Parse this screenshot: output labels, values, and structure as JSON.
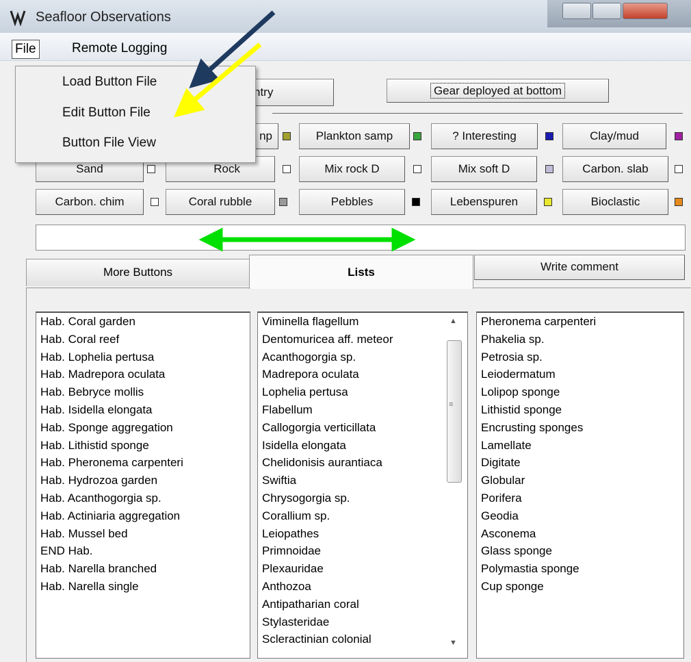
{
  "window": {
    "title": "Seafloor Observations"
  },
  "menubar": {
    "file": "File",
    "remote": "Remote Logging"
  },
  "file_menu": {
    "items": [
      "Load Button File",
      "Edit Button File",
      "Button File View"
    ]
  },
  "toolbar": {
    "entry_label": "ntry",
    "gear_label": "Gear deployed at bottom"
  },
  "buttons_row1": [
    {
      "label": "np",
      "color": "#a0a030"
    },
    {
      "label": "Plankton samp",
      "color": "#3aa640"
    },
    {
      "label": "? Interesting",
      "color": "#1b1bb0"
    },
    {
      "label": "Clay/mud",
      "color": "#a020a0"
    }
  ],
  "buttons_row2": [
    {
      "label": "Sand",
      "color": "#ffffff"
    },
    {
      "label": "Rock",
      "color": "#ffffff"
    },
    {
      "label": "Mix rock D",
      "color": "#ffffff"
    },
    {
      "label": "Mix soft D",
      "color": "#c0bcd8"
    },
    {
      "label": "Carbon. slab",
      "color": "#ffffff"
    }
  ],
  "buttons_row3": [
    {
      "label": "Carbon. chim",
      "color": "#ffffff"
    },
    {
      "label": "Coral rubble",
      "color": "#9a9a9a"
    },
    {
      "label": "Pebbles",
      "color": "#000000"
    },
    {
      "label": "Lebenspuren",
      "color": "#e8e830"
    },
    {
      "label": "Bioclastic",
      "color": "#e68a1e"
    }
  ],
  "tabs": {
    "more": "More Buttons",
    "lists": "Lists",
    "write_comment": "Write comment"
  },
  "list_habitats": [
    "Hab. Coral garden",
    "Hab. Coral reef",
    "Hab. Lophelia pertusa",
    "Hab. Madrepora oculata",
    "Hab. Bebryce mollis",
    "Hab. Isidella elongata",
    "Hab. Sponge aggregation",
    "Hab. Lithistid sponge",
    "Hab. Pheronema carpenteri",
    "Hab. Hydrozoa garden",
    "Hab. Acanthogorgia sp.",
    "Hab. Actiniaria aggregation",
    "Hab. Mussel bed",
    "END Hab.",
    "Hab. Narella branched",
    "Hab. Narella single"
  ],
  "list_corals": [
    "Viminella flagellum",
    "Dentomuricea aff. meteor",
    "Acanthogorgia sp.",
    "Madrepora oculata",
    "Lophelia pertusa",
    "Flabellum",
    "Callogorgia verticillata",
    "Isidella elongata",
    "Chelidonisis aurantiaca",
    "Swiftia",
    "Chrysogorgia sp.",
    "Corallium sp.",
    "Leiopathes",
    "Primnoidae",
    "Plexauridae",
    "Anthozoa",
    "Antipatharian coral",
    "Stylasteridae",
    "Scleractinian colonial"
  ],
  "list_sponges": [
    "Pheronema carpenteri",
    "Phakelia sp.",
    "Petrosia sp.",
    "Leiodermatum",
    "Lolipop sponge",
    "Lithistid sponge",
    "Encrusting sponges",
    "Lamellate",
    "Digitate",
    "Globular",
    "Porifera",
    "Geodia",
    "Asconema",
    "Glass sponge",
    "Polymastia sponge",
    "Cup sponge"
  ],
  "annotation_colors": {
    "navy_arrow": "#1f3a5f",
    "yellow_arrow": "#ffff00",
    "green_arrow": "#00ff00"
  }
}
